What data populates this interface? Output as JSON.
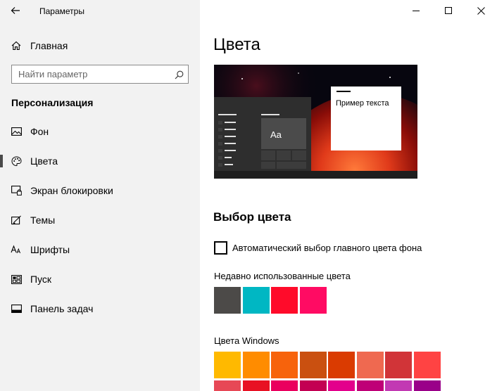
{
  "window": {
    "title": "Параметры",
    "controls": [
      "minimize",
      "maximize",
      "close"
    ]
  },
  "sidebar": {
    "home_label": "Главная",
    "search_placeholder": "Найти параметр",
    "section_title": "Персонализация",
    "items": [
      {
        "label": "Фон",
        "icon": "picture-icon",
        "selected": false
      },
      {
        "label": "Цвета",
        "icon": "palette-icon",
        "selected": true
      },
      {
        "label": "Экран блокировки",
        "icon": "lock-screen-icon",
        "selected": false
      },
      {
        "label": "Темы",
        "icon": "themes-icon",
        "selected": false
      },
      {
        "label": "Шрифты",
        "icon": "fonts-icon",
        "selected": false
      },
      {
        "label": "Пуск",
        "icon": "start-icon",
        "selected": false
      },
      {
        "label": "Панель задач",
        "icon": "taskbar-icon",
        "selected": false
      }
    ]
  },
  "main": {
    "title": "Цвета",
    "preview": {
      "tile_text": "Aa",
      "sample_text": "Пример текста"
    },
    "color_choice_heading": "Выбор цвета",
    "auto_checkbox_label": "Автоматический выбор главного цвета фона",
    "auto_checkbox_checked": false,
    "recent_label": "Недавно использованные цвета",
    "recent_colors": [
      "#4c4a48",
      "#00b7c3",
      "#ff0b2a",
      "#ff0b63"
    ],
    "windows_colors_label": "Цвета Windows",
    "windows_colors_row1": [
      "#ffb900",
      "#ff8c00",
      "#f7630c",
      "#ca5010",
      "#da3b01",
      "#ef6950",
      "#d13438",
      "#ff4343"
    ],
    "windows_colors_row2": [
      "#e74856",
      "#e81123",
      "#ea005e",
      "#c30052",
      "#e3008c",
      "#bf0077",
      "#c239b3",
      "#9a0089"
    ]
  }
}
